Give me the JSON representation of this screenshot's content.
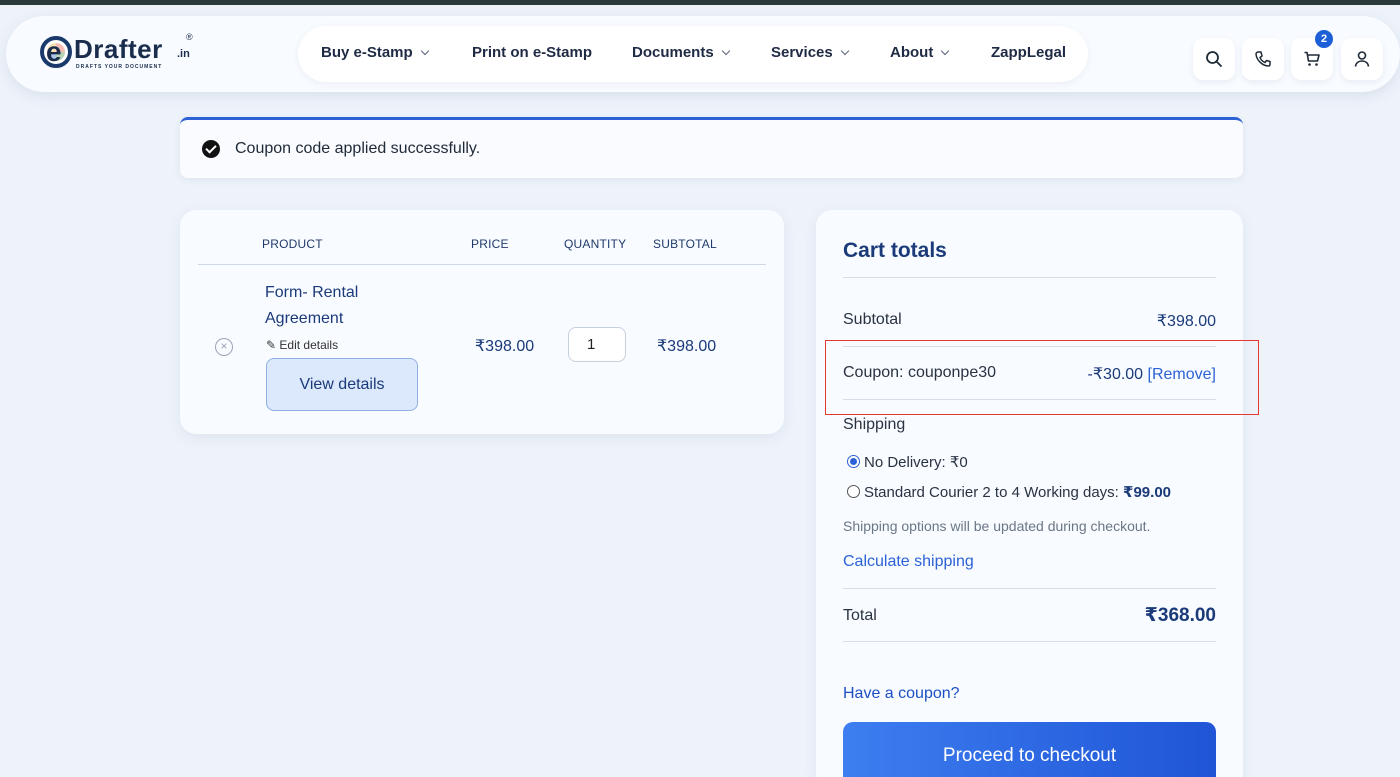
{
  "brand": {
    "logo_main": "Drafter",
    "logo_e": "e",
    "logo_suffix": ".in",
    "logo_reg": "®",
    "logo_tagline": "DRAFTS YOUR DOCUMENT"
  },
  "nav": {
    "items": [
      {
        "label": "Buy e-Stamp",
        "dropdown": true
      },
      {
        "label": "Print on e-Stamp",
        "dropdown": false
      },
      {
        "label": "Documents",
        "dropdown": true
      },
      {
        "label": "Services",
        "dropdown": true
      },
      {
        "label": "About",
        "dropdown": true
      },
      {
        "label": "ZappLegal",
        "dropdown": false
      }
    ]
  },
  "header_icons": [
    "search-icon",
    "phone-icon",
    "cart-icon",
    "user-icon"
  ],
  "cart_count": "2",
  "notice": {
    "text": "Coupon code applied successfully."
  },
  "cart_table": {
    "headers": {
      "product": "PRODUCT",
      "price": "PRICE",
      "quantity": "QUANTITY",
      "subtotal": "SUBTOTAL"
    },
    "rows": [
      {
        "remove_symbol": "×",
        "product_name": "Form- Rental Agreement",
        "edit_label": "✎ Edit details",
        "view_label": "View details",
        "price": "₹398.00",
        "quantity": "1",
        "subtotal": "₹398.00"
      }
    ]
  },
  "totals": {
    "title": "Cart totals",
    "subtotal_label": "Subtotal",
    "subtotal_value": "₹398.00",
    "coupon_label": "Coupon: couponpe30",
    "coupon_value": "-₹30.00",
    "coupon_remove": "[Remove]",
    "shipping_label": "Shipping",
    "shipping_options": [
      {
        "label": "No Delivery: ",
        "price": "₹0",
        "selected": true
      },
      {
        "label": "Standard Courier 2 to 4 Working days: ",
        "price": "₹99.00",
        "selected": false
      }
    ],
    "shipping_note": "Shipping options will be updated during checkout.",
    "calc_shipping": "Calculate shipping",
    "total_label": "Total",
    "total_value": "₹368.00",
    "coupon_link": "Have a coupon?",
    "checkout_label": "Proceed to checkout"
  },
  "colors": {
    "accent": "#2c62d6",
    "highlight": "#e23a2e",
    "text_dark_blue": "#1a3a7a"
  }
}
